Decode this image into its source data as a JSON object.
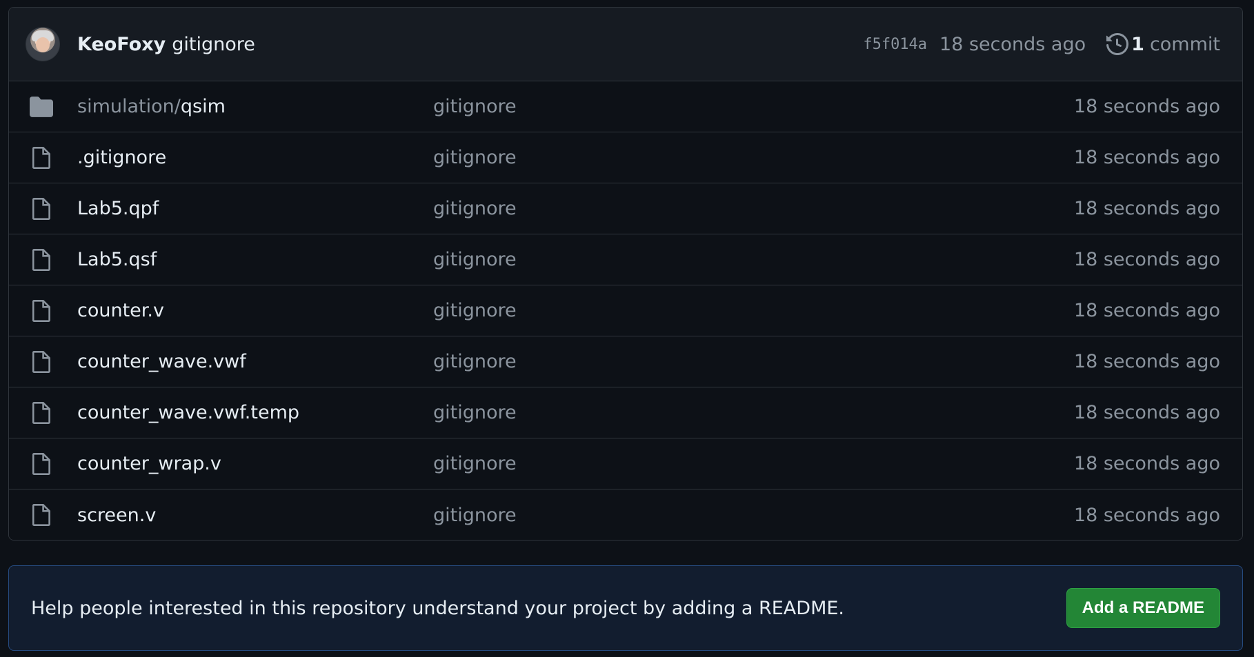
{
  "latest_commit": {
    "author": "KeoFoxy",
    "message": "gitignore",
    "sha": "f5f014a",
    "time": "18 seconds ago",
    "history_count": "1",
    "history_label": "commit"
  },
  "files": [
    {
      "type": "folder",
      "name_prefix": "simulation/",
      "name": "qsim",
      "commit": "gitignore",
      "time": "18 seconds ago"
    },
    {
      "type": "file",
      "name_prefix": "",
      "name": ".gitignore",
      "commit": "gitignore",
      "time": "18 seconds ago"
    },
    {
      "type": "file",
      "name_prefix": "",
      "name": "Lab5.qpf",
      "commit": "gitignore",
      "time": "18 seconds ago"
    },
    {
      "type": "file",
      "name_prefix": "",
      "name": "Lab5.qsf",
      "commit": "gitignore",
      "time": "18 seconds ago"
    },
    {
      "type": "file",
      "name_prefix": "",
      "name": "counter.v",
      "commit": "gitignore",
      "time": "18 seconds ago"
    },
    {
      "type": "file",
      "name_prefix": "",
      "name": "counter_wave.vwf",
      "commit": "gitignore",
      "time": "18 seconds ago"
    },
    {
      "type": "file",
      "name_prefix": "",
      "name": "counter_wave.vwf.temp",
      "commit": "gitignore",
      "time": "18 seconds ago"
    },
    {
      "type": "file",
      "name_prefix": "",
      "name": "counter_wrap.v",
      "commit": "gitignore",
      "time": "18 seconds ago"
    },
    {
      "type": "file",
      "name_prefix": "",
      "name": "screen.v",
      "commit": "gitignore",
      "time": "18 seconds ago"
    }
  ],
  "readme_prompt": {
    "text": "Help people interested in this repository understand your project by adding a README.",
    "button_label": "Add a README"
  },
  "colors": {
    "background": "#0d1117",
    "header_bg": "#161b22",
    "border": "#30363d",
    "muted_text": "#8b949e",
    "primary_text": "#e6edf3",
    "button_green": "#238636",
    "readme_bg": "#121d2f"
  }
}
